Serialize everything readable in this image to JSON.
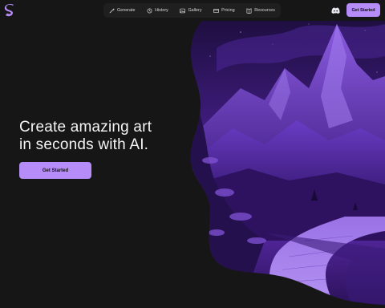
{
  "brand": {
    "logo_icon": "s-logo-icon",
    "accent": "#b58cf8"
  },
  "nav": {
    "items": [
      {
        "label": "Generate",
        "icon": "magic-wand-icon"
      },
      {
        "label": "History",
        "icon": "history-icon"
      },
      {
        "label": "Gallery",
        "icon": "image-icon"
      },
      {
        "label": "Pricing",
        "icon": "credit-card-icon"
      },
      {
        "label": "Resources",
        "icon": "book-icon"
      }
    ]
  },
  "header": {
    "discord_icon": "discord-icon",
    "cta_label": "Get Started"
  },
  "hero": {
    "title_line1": "Create amazing art",
    "title_line2": "in seconds with AI.",
    "cta_label": "Get Started",
    "image": "purple-mountain-path-artwork"
  }
}
